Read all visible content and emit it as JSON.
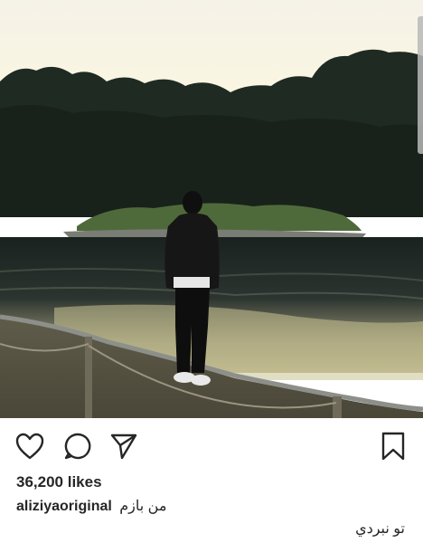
{
  "post": {
    "photo_icon": "photo-of-man-at-lake",
    "likes": "36,200 likes",
    "username": "aliziyaoriginal",
    "caption_line1": "من بازم",
    "caption_line2": "تو نبردي"
  },
  "actions": {
    "like_icon": "heart-icon",
    "comment_icon": "comment-icon",
    "share_icon": "send-icon",
    "save_icon": "bookmark-icon"
  }
}
